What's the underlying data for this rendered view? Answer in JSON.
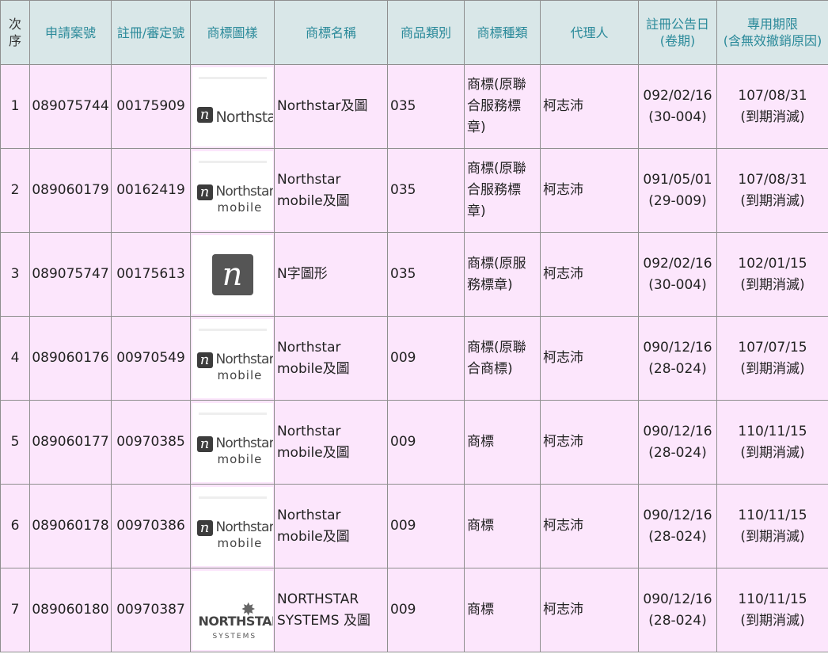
{
  "headers": {
    "seq": "次序",
    "app_no": "申請案號",
    "reg_no": "註冊/審定號",
    "image": "商標圖樣",
    "name": "商標名稱",
    "class": "商品類別",
    "kind": "商標種類",
    "agent": "代理人",
    "pub_date": "註冊公告日",
    "pub_issue": "(卷期)",
    "term": "專用期限",
    "term_note": "(含無效撤銷原因)"
  },
  "rows": [
    {
      "seq": "1",
      "app_no": "089075744",
      "reg_no": "00175909",
      "logo_text": "Northstar",
      "logo_text2": "",
      "name_l1": "Northstar及圖",
      "name_l2": "",
      "class": "035",
      "kind_l1": "商標(原聯",
      "kind_l2": "合服務標",
      "kind_l3": "章)",
      "agent": "柯志沛",
      "date": "092/02/16",
      "issue": "(30-004)",
      "term": "107/08/31",
      "term_note": "(到期消滅)"
    },
    {
      "seq": "2",
      "app_no": "089060179",
      "reg_no": "00162419",
      "logo_text": "Northstar",
      "logo_text2": "mobile",
      "name_l1": "Northstar",
      "name_l2": "mobile及圖",
      "class": "035",
      "kind_l1": "商標(原聯",
      "kind_l2": "合服務標",
      "kind_l3": "章)",
      "agent": "柯志沛",
      "date": "091/05/01",
      "issue": "(29-009)",
      "term": "107/08/31",
      "term_note": "(到期消滅)"
    },
    {
      "seq": "3",
      "app_no": "089075747",
      "reg_no": "00175613",
      "logo_text": "",
      "logo_text2": "",
      "name_l1": "N字圖形",
      "name_l2": "",
      "class": "035",
      "kind_l1": "商標(原服",
      "kind_l2": "務標章)",
      "kind_l3": "",
      "agent": "柯志沛",
      "date": "092/02/16",
      "issue": "(30-004)",
      "term": "102/01/15",
      "term_note": "(到期消滅)"
    },
    {
      "seq": "4",
      "app_no": "089060176",
      "reg_no": "00970549",
      "logo_text": "Northstar",
      "logo_text2": "mobile",
      "name_l1": "Northstar",
      "name_l2": "mobile及圖",
      "class": "009",
      "kind_l1": "商標(原聯",
      "kind_l2": "合商標)",
      "kind_l3": "",
      "agent": "柯志沛",
      "date": "090/12/16",
      "issue": "(28-024)",
      "term": "107/07/15",
      "term_note": "(到期消滅)"
    },
    {
      "seq": "5",
      "app_no": "089060177",
      "reg_no": "00970385",
      "logo_text": "Northstar",
      "logo_text2": "mobile",
      "name_l1": "Northstar",
      "name_l2": "mobile及圖",
      "class": "009",
      "kind_l1": "商標",
      "kind_l2": "",
      "kind_l3": "",
      "agent": "柯志沛",
      "date": "090/12/16",
      "issue": "(28-024)",
      "term": "110/11/15",
      "term_note": "(到期消滅)"
    },
    {
      "seq": "6",
      "app_no": "089060178",
      "reg_no": "00970386",
      "logo_text": "Northstar",
      "logo_text2": "mobile",
      "name_l1": "Northstar",
      "name_l2": "mobile及圖",
      "class": "009",
      "kind_l1": "商標",
      "kind_l2": "",
      "kind_l3": "",
      "agent": "柯志沛",
      "date": "090/12/16",
      "issue": "(28-024)",
      "term": "110/11/15",
      "term_note": "(到期消滅)"
    },
    {
      "seq": "7",
      "app_no": "089060180",
      "reg_no": "00970387",
      "logo_text": "NORTHSTAR",
      "logo_text2": "SYSTEMS",
      "name_l1": "NORTHSTAR",
      "name_l2": "SYSTEMS 及圖",
      "class": "009",
      "kind_l1": "商標",
      "kind_l2": "",
      "kind_l3": "",
      "agent": "柯志沛",
      "date": "090/12/16",
      "issue": "(28-024)",
      "term": "110/11/15",
      "term_note": "(到期消滅)"
    }
  ]
}
